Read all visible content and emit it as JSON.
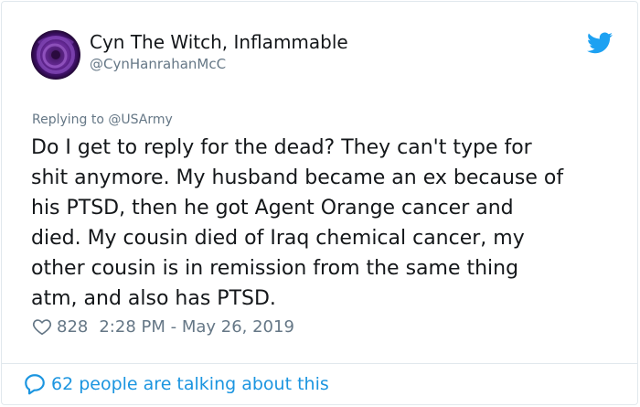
{
  "tweet": {
    "author_name": "Cyn The Witch, Inflammable",
    "author_handle": "@CynHanrahanMcC",
    "replying_to": "Replying to @USArmy",
    "lines": [
      "Do I get to reply for the dead? They can't type for",
      "shit anymore. My husband became an ex because of",
      "his PTSD, then he got Agent Orange cancer and",
      "died. My cousin died of Iraq chemical cancer, my",
      "other cousin is in remission from the same thing",
      "atm, and also has PTSD."
    ],
    "likes": "828",
    "timestamp": "2:28 PM - May 26, 2019"
  },
  "footer": {
    "talking": "62 people are talking about this"
  },
  "icons": {
    "brand": "twitter-bird-icon",
    "like": "heart-icon",
    "conversation": "speech-bubble-icon"
  },
  "colors": {
    "brand": "#1da1f2",
    "link": "#1b95e0",
    "text": "#14171a",
    "muted": "#657786",
    "border": "#e1e8ed"
  }
}
